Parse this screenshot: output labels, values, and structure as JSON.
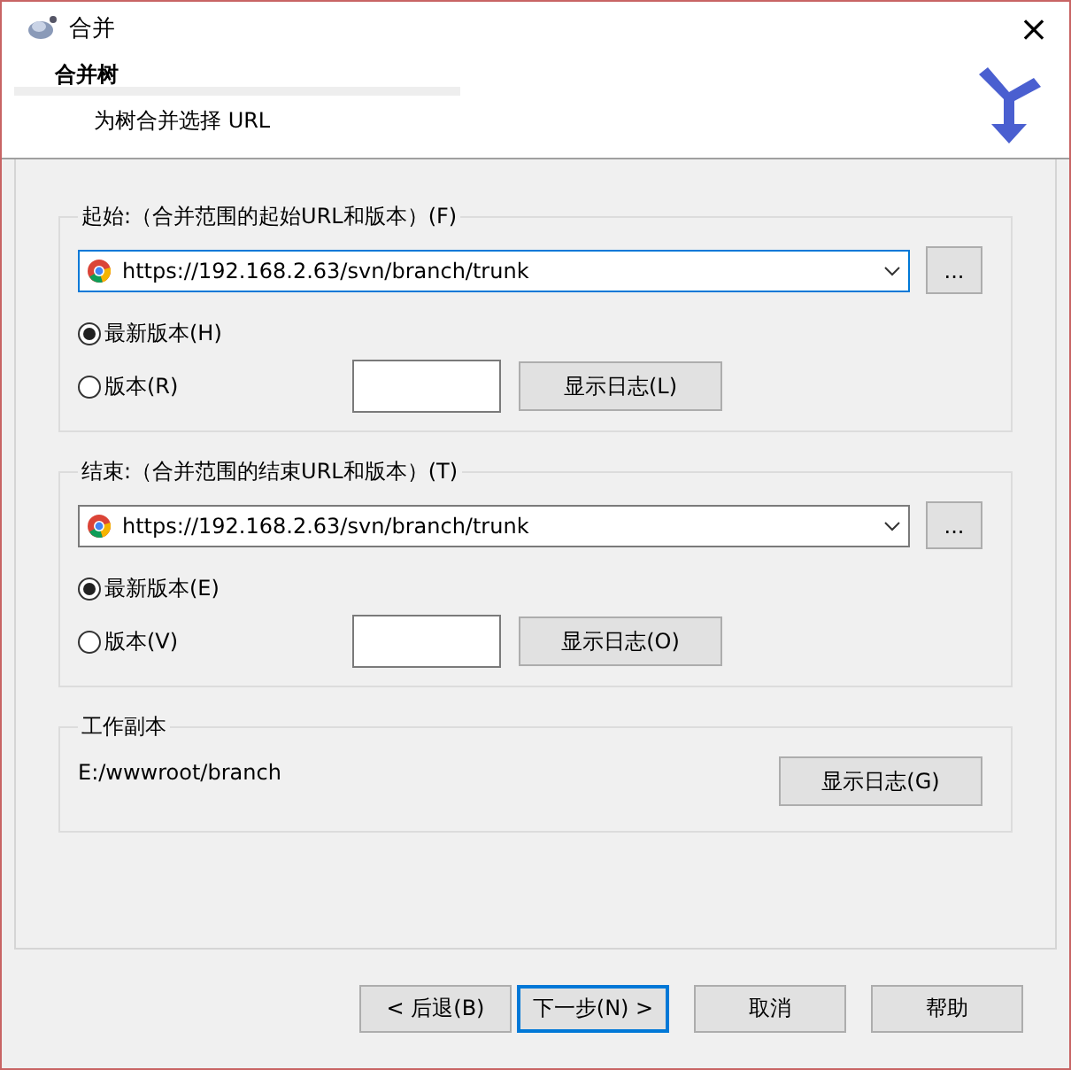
{
  "window": {
    "title": "合并",
    "close": "×"
  },
  "header": {
    "title": "合并树",
    "subtitle": "为树合并选择 URL"
  },
  "groups": [
    {
      "kind": "range",
      "label": "起始:（合并范围的起始URL和版本）(F)",
      "url": "https://192.168.2.63/svn/branch/trunk",
      "browse": "...",
      "focused": true,
      "options": [
        {
          "label": "最新版本(H)",
          "selected": true
        },
        {
          "label": "版本(R)",
          "selected": false
        }
      ],
      "log_button": "显示日志(L)"
    },
    {
      "kind": "range",
      "label": "结束:（合并范围的结束URL和版本）(T)",
      "url": "https://192.168.2.63/svn/branch/trunk",
      "browse": "...",
      "focused": false,
      "options": [
        {
          "label": "最新版本(E)",
          "selected": true
        },
        {
          "label": "版本(V)",
          "selected": false
        }
      ],
      "log_button": "显示日志(O)"
    },
    {
      "kind": "working_copy",
      "label": "工作副本",
      "path": "E:/wwwroot/branch",
      "log_button": "显示日志(G)"
    }
  ],
  "buttons": [
    {
      "label": "< 后退(B)",
      "default": false
    },
    {
      "label": "下一步(N) >",
      "default": true
    },
    {
      "label": "取消",
      "default": false
    },
    {
      "label": "帮助",
      "default": false
    }
  ]
}
